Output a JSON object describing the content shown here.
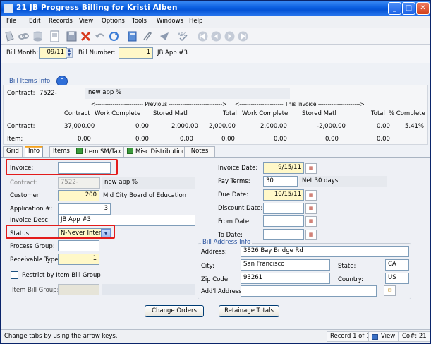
{
  "window": {
    "title": "21 JB Progress Billing for Kristi Alben"
  },
  "menu": [
    "File",
    "Edit",
    "Records",
    "View",
    "Options",
    "Tools",
    "Windows",
    "Help"
  ],
  "header": {
    "bill_month_label": "Bill Month:",
    "bill_month_value": "09/11",
    "bill_number_label": "Bill Number:",
    "bill_number_value": "1",
    "bill_desc": "JB App #3"
  },
  "bill_items": {
    "title": "Bill Items Info",
    "contract_label": "Contract:",
    "contract_value": "7522-",
    "contract_desc": "new app %",
    "previous_header": "<------------------------- Previous ---------------------------->",
    "this_invoice_header": "<----------------------- This Invoice ---------------------->",
    "columns": [
      "Contract",
      "Work Complete",
      "Stored Matl",
      "Total",
      "Work Complete",
      "Stored Matl",
      "Total",
      "% Complete"
    ],
    "rows": [
      {
        "label": "Contract:",
        "values": [
          "37,000.00",
          "0.00",
          "2,000.00",
          "2,000.00",
          "2,000.00",
          "-2,000.00",
          "0.00",
          "5.41%"
        ]
      },
      {
        "label": "Item:",
        "values": [
          "0.00",
          "0.00",
          "0.00",
          "0.00",
          "0.00",
          "0.00",
          "0.00",
          ""
        ]
      }
    ]
  },
  "tabs": [
    "Grid",
    "Info",
    "Items",
    "Item SM/Tax",
    "Misc Distributions",
    "Notes"
  ],
  "info": {
    "invoice_label": "Invoice:",
    "invoice_value": "",
    "contract_label": "Contract:",
    "contract_value": "7522-",
    "contract_desc": "new app %",
    "customer_label": "Customer:",
    "customer_value": "200",
    "customer_name": "Mid City Board of Education",
    "application_label": "Application #:",
    "application_value": "3",
    "invoice_desc_label": "Invoice Desc:",
    "invoice_desc_value": "JB App #3",
    "status_label": "Status:",
    "status_value": "N-Never Interfi",
    "process_group_label": "Process Group:",
    "receivable_type_label": "Receivable Type:",
    "receivable_type_value": "1",
    "restrict_label": "Restrict by Item Bill Group",
    "item_bill_group_label": "Item Bill Group:",
    "invoice_date_label": "Invoice Date:",
    "invoice_date_value": "9/15/11",
    "pay_terms_label": "Pay Terms:",
    "pay_terms_value": "30",
    "pay_terms_desc": "Net 30 days",
    "due_date_label": "Due Date:",
    "due_date_value": "10/15/11",
    "discount_date_label": "Discount Date:",
    "from_date_label": "From Date:",
    "to_date_label": "To Date:",
    "bill_address_title": "Bill Address Info",
    "address_label": "Address:",
    "address_value": "3826 Bay Bridge Rd",
    "city_label": "City:",
    "city_value": "San Francisco",
    "state_label": "State:",
    "state_value": "CA",
    "zip_label": "Zip Code:",
    "zip_value": "93261",
    "country_label": "Country:",
    "country_value": "US",
    "addl_address_label": "Add'l Address:"
  },
  "buttons": {
    "change_orders": "Change Orders",
    "retainage_totals": "Retainage Totals"
  },
  "status": {
    "hint": "Change tabs by using the arrow keys.",
    "record": "Record 1 of 1",
    "view": "View",
    "co": "Co#: 21"
  }
}
